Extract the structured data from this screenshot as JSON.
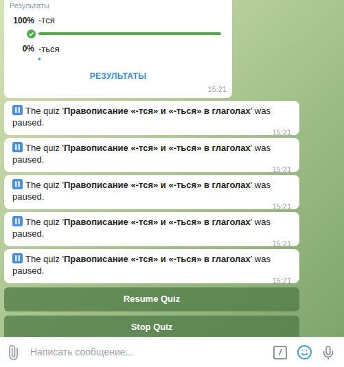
{
  "poll": {
    "header": "Результаты",
    "options": [
      {
        "percent": "100%",
        "label": "-тся",
        "level": 1,
        "selected": true
      },
      {
        "percent": "0%",
        "label": "-ться",
        "level": 0,
        "selected": false
      }
    ],
    "button": "РЕЗУЛЬТАТЫ",
    "time": "15:21"
  },
  "messages": [
    {
      "prefix": "The quiz '",
      "title": "Правописание «-тся» и «-ться» в глаголах",
      "suffix": "' was paused.",
      "time": "15:21"
    },
    {
      "prefix": "The quiz '",
      "title": "Правописание «-тся» и «-ться» в глаголах",
      "suffix": "' was paused.",
      "time": "15:21"
    },
    {
      "prefix": "The quiz '",
      "title": "Правописание «-тся» и «-ться» в глаголах",
      "suffix": "' was paused.",
      "time": "15:21"
    },
    {
      "prefix": "The quiz '",
      "title": "Правописание «-тся» и «-ться» в глаголах",
      "suffix": "' was paused.",
      "time": "15:21"
    },
    {
      "prefix": "The quiz '",
      "title": "Правописание «-тся» и «-ться» в глаголах",
      "suffix": "' was paused.",
      "time": "15:21"
    }
  ],
  "keyboard": [
    "Resume Quiz",
    "Stop Quiz"
  ],
  "input": {
    "placeholder": "Написать сообщение...",
    "command": "/"
  }
}
